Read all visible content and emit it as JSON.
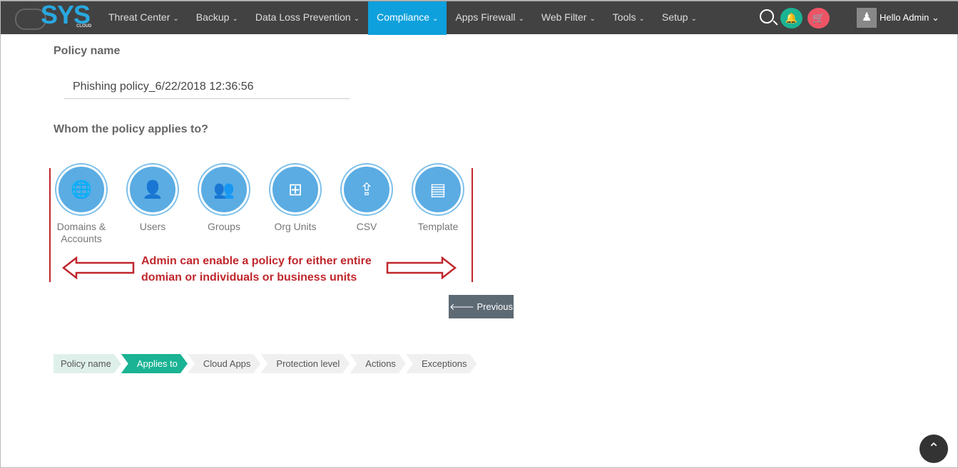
{
  "nav": {
    "logo": "SYS",
    "logo_sub": "CLOUD",
    "items": [
      "Threat Center",
      "Backup",
      "Data Loss Prevention",
      "Compliance",
      "Apps Firewall",
      "Web Filter",
      "Tools",
      "Setup"
    ],
    "active": "Compliance",
    "user": "Hello  Admin"
  },
  "form": {
    "policy_name_label": "Policy name",
    "policy_name_value": "Phishing policy_6/22/2018 12:36:56",
    "applies_label": "Whom the policy applies to?",
    "options": [
      {
        "label": "Domains & Accounts",
        "icon": "globe-icon",
        "glyph": "🌐"
      },
      {
        "label": "Users",
        "icon": "user-icon",
        "glyph": "👤"
      },
      {
        "label": "Groups",
        "icon": "group-icon",
        "glyph": "👥"
      },
      {
        "label": "Org Units",
        "icon": "org-units-icon",
        "glyph": "⊞"
      },
      {
        "label": "CSV",
        "icon": "upload-icon",
        "glyph": "⇪"
      },
      {
        "label": "Template",
        "icon": "template-icon",
        "glyph": "▤"
      }
    ]
  },
  "annotation": {
    "line1": "Admin can enable a policy for either entire",
    "line2": "domian or individuals or business units",
    "color": "#c0272d"
  },
  "previous_label": "🡐 Previous",
  "steps": [
    "Policy name",
    "Applies to",
    "Cloud Apps",
    "Protection level",
    "Actions",
    "Exceptions"
  ],
  "active_step": "Applies to",
  "colors": {
    "accent": "#0ea0dc",
    "step_active": "#1ab394",
    "icon_circle": "#5aace3"
  }
}
